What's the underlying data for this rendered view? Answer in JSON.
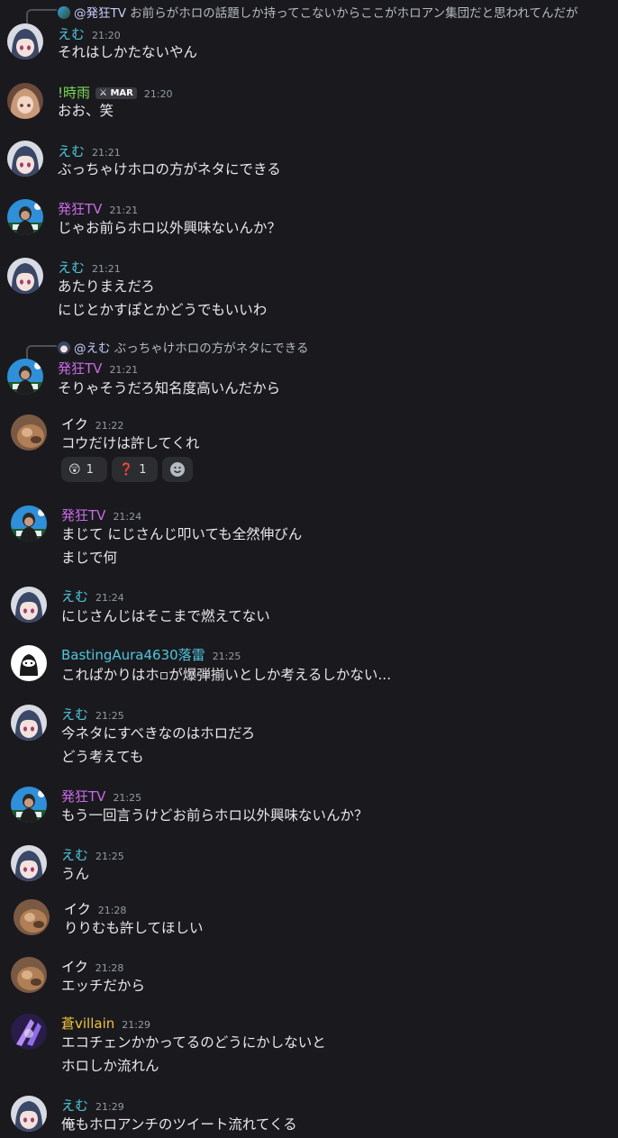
{
  "messages": [
    {
      "reply": {
        "mention": "@発狂TV",
        "text": "お前らがホロの話題しか持ってこないからここがホロアン集団だと思われてんだが"
      },
      "user": "えむ",
      "time": "21:20",
      "lines": [
        "それはしかたないやん"
      ]
    },
    {
      "user": "!時雨",
      "tag": "MAR",
      "time": "21:20",
      "lines": [
        "おお、笑"
      ]
    },
    {
      "user": "えむ",
      "time": "21:21",
      "lines": [
        "ぶっちゃけホロの方がネタにできる"
      ]
    },
    {
      "user": "発狂TV",
      "time": "21:21",
      "lines": [
        "じゃお前らホロ以外興味ないんか？"
      ]
    },
    {
      "user": "えむ",
      "time": "21:21",
      "lines": [
        "あたりまえだろ",
        "にじとかすぽとかどうでもいいわ"
      ]
    },
    {
      "reply": {
        "mention": "@えむ",
        "text": "ぶっちゃけホロの方がネタにできる"
      },
      "user": "発狂TV",
      "time": "21:21",
      "lines": [
        "そりゃそうだろ知名度高いんだから"
      ]
    },
    {
      "user": "イク",
      "time": "21:22",
      "lines": [
        "コウだけは許してくれ"
      ],
      "reactions": [
        {
          "emoji": "😲",
          "count": "1"
        },
        {
          "emoji": "❓",
          "count": "1"
        }
      ]
    },
    {
      "user": "発狂TV",
      "time": "21:24",
      "lines": [
        "まじて にじさんじ叩いても全然伸びん",
        "まじで何"
      ]
    },
    {
      "user": "えむ",
      "time": "21:24",
      "lines": [
        "にじさんじはそこまで燃えてない"
      ]
    },
    {
      "user": "BastingAura4630落雷",
      "time": "21:25",
      "lines": [
        "これぱかりはホ▫が爆弾揃いとしか考えるしかない..."
      ]
    },
    {
      "user": "えむ",
      "time": "21:25",
      "lines": [
        "今ネタにすべきなのはホロだろ",
        "どう考えても"
      ]
    },
    {
      "user": "発狂TV",
      "time": "21:25",
      "lines": [
        "もう一回言うけどお前らホロ以外興味ないんか？"
      ]
    },
    {
      "user": "えむ",
      "time": "21:25",
      "lines": [
        "うん"
      ]
    },
    {
      "user": "イク",
      "time": "21:28",
      "lines": [
        "りりむも許してほしい"
      ]
    },
    {
      "user": "イク",
      "time": "21:28",
      "lines": [
        "エッチだから"
      ]
    },
    {
      "user": "蒼villain",
      "time": "21:29",
      "lines": [
        "エコチェンかかってるのどうにかしないと",
        "ホロしか流れん"
      ]
    },
    {
      "user": "えむ",
      "time": "21:29",
      "lines": [
        "俺もホロアンチのツイート流れてくる"
      ]
    }
  ],
  "colors": {
    "background": "#1a1a1e",
    "emu": "#4fc6dd",
    "hakkyo": "#c86be6",
    "shigure": "#7dd956",
    "ao": "#f0c33a"
  }
}
